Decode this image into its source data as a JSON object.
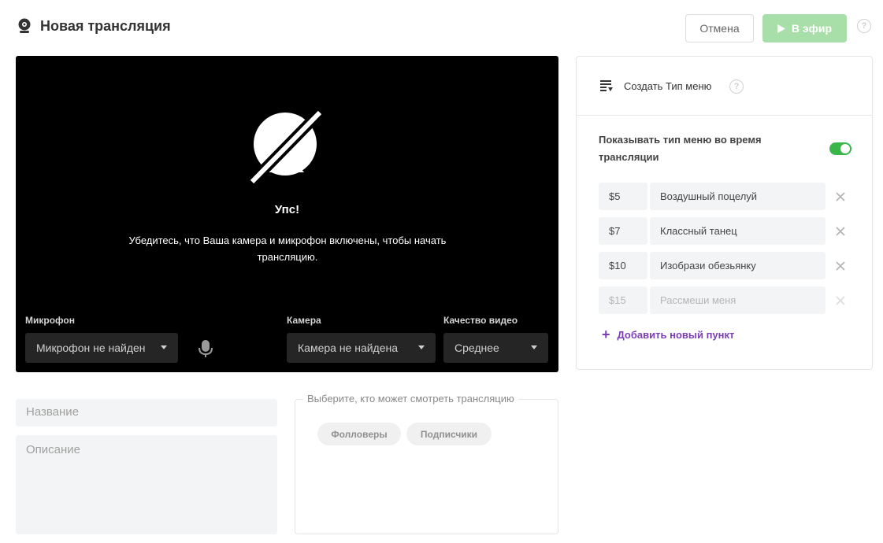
{
  "header": {
    "title": "Новая трансляция",
    "title_icon": "webcam-icon",
    "cancel_label": "Отмена",
    "live_label": "В эфир",
    "live_icon": "play-icon",
    "help_icon": "question-circle-icon"
  },
  "video": {
    "icon": "camera-off-icon",
    "oops": "Упс!",
    "hint": "Убедитесь, что Ваша камера и микрофон включены, чтобы начать трансляцию.",
    "mic_label": "Микрофон",
    "mic_value": "Микрофон не найден",
    "camera_label": "Камера",
    "camera_value": "Камера не найдена",
    "quality_label": "Качество видео",
    "quality_value": "Среднее",
    "mic_icon": "microphone-icon"
  },
  "form": {
    "name_placeholder": "Название",
    "description_placeholder": "Описание"
  },
  "audience": {
    "legend": "Выберите, кто может смотреть трансляцию",
    "options": [
      "Фолловеры",
      "Подписчики"
    ]
  },
  "menu": {
    "title": "Создать Тип меню",
    "title_icon": "menu-list-icon",
    "show_label": "Показывать тип меню во время трансляции",
    "show_enabled": true,
    "items": [
      {
        "price": "$5",
        "name": "Воздушный поцелуй"
      },
      {
        "price": "$7",
        "name": "Классный танец"
      },
      {
        "price": "$10",
        "name": "Изобрази обезьянку"
      }
    ],
    "placeholder_item": {
      "price": "$15",
      "name": "Рассмеши меня"
    },
    "add_label": "Добавить новый пункт"
  },
  "colors": {
    "accent_green": "#3ab54a",
    "live_button": "#a8dfa8",
    "add_link": "#7a3fb5"
  }
}
